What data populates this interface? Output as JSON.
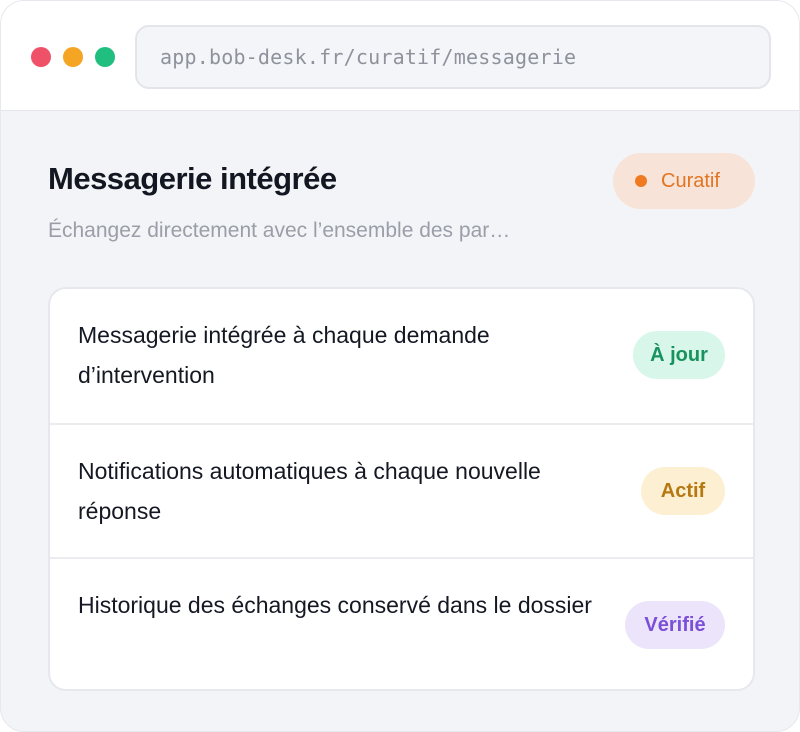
{
  "browser": {
    "url": "app.bob-desk.fr/curatif/messagerie"
  },
  "header": {
    "title": "Messagerie intégrée",
    "subtitle": "Échangez directement avec l’ensemble des par…",
    "badge": "Curatif"
  },
  "features": [
    {
      "text": "Messagerie intégrée à chaque demande d’intervention",
      "status": "À jour"
    },
    {
      "text": "Notifications automatiques à chaque nouvelle réponse",
      "status": "Actif"
    },
    {
      "text": "Historique des échanges conservé dans le dossier",
      "status": "Vérifié"
    }
  ],
  "colors": {
    "traffic_red": "#ef5169",
    "traffic_yellow": "#f5a524",
    "traffic_green": "#21bf7f",
    "accent_orange": "#e27522",
    "status_green": "#18935e",
    "status_yellow": "#b67912",
    "status_purple": "#7b4fd8"
  }
}
